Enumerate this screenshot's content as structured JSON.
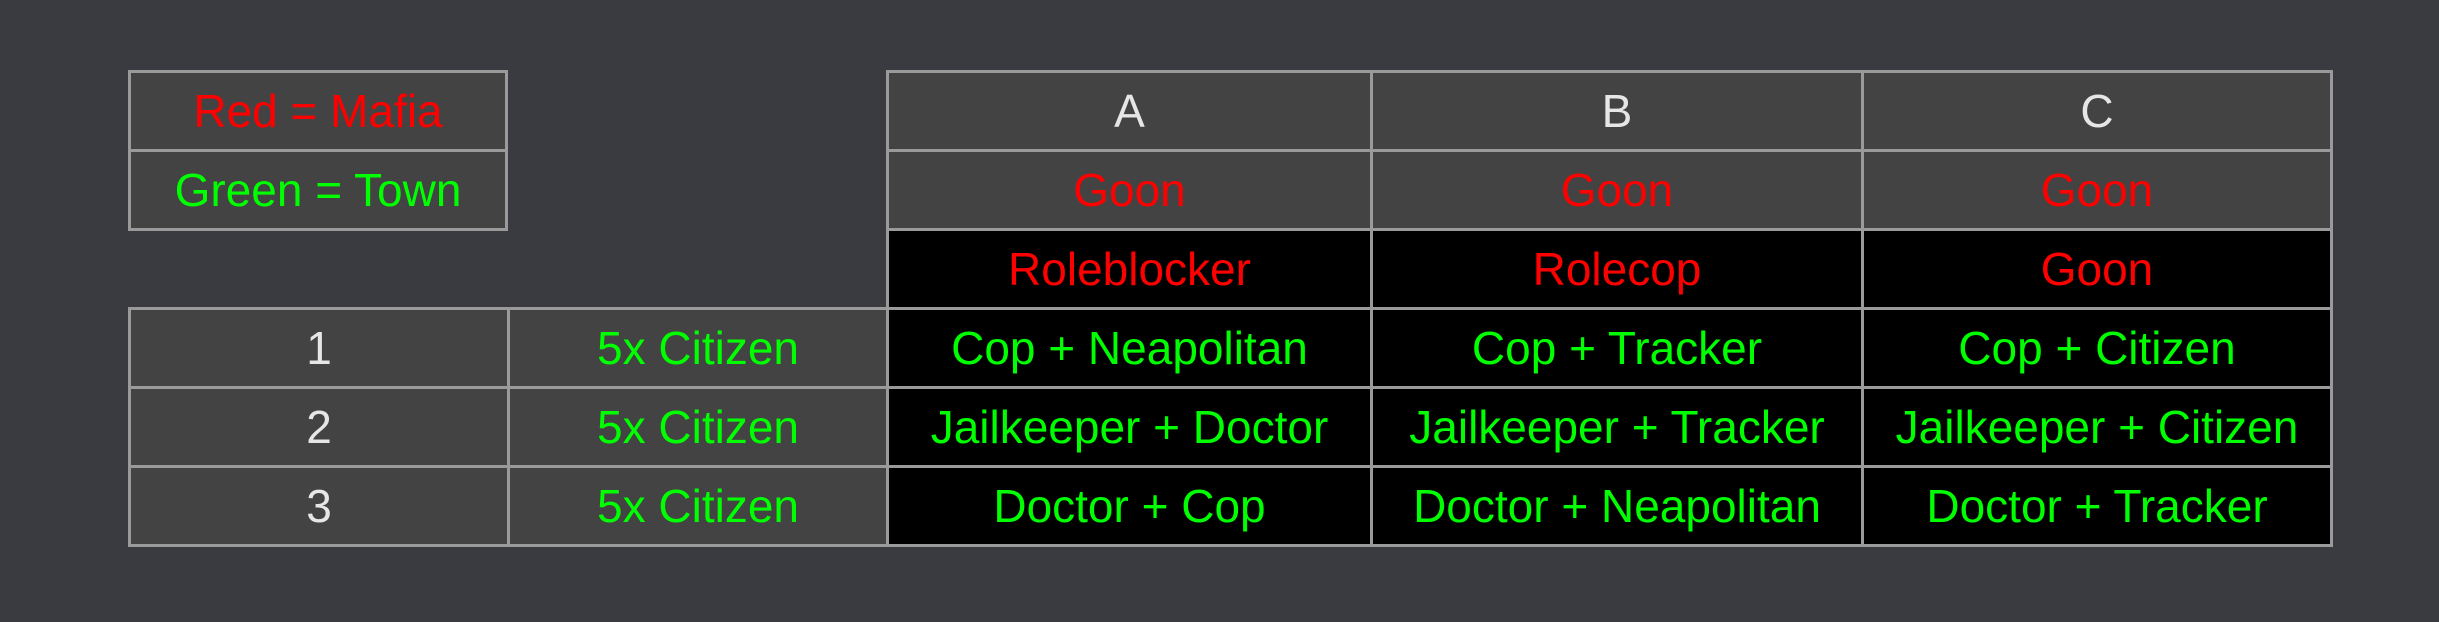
{
  "legend": [
    {
      "text": "Red = Mafia",
      "color": "#ff0000"
    },
    {
      "text": "Green = Town",
      "color": "#00ff00"
    }
  ],
  "columns": [
    "A",
    "B",
    "C"
  ],
  "mafia_rows": [
    [
      "Goon",
      "Goon",
      "Goon"
    ],
    [
      "Roleblocker",
      "Rolecop",
      "Goon"
    ]
  ],
  "town_rows": [
    {
      "label": "1",
      "base": "5x Citizen",
      "cells": [
        "Cop + Neapolitan",
        "Cop + Tracker",
        "Cop + Citizen"
      ]
    },
    {
      "label": "2",
      "base": "5x Citizen",
      "cells": [
        "Jailkeeper + Doctor",
        "Jailkeeper + Tracker",
        "Jailkeeper + Citizen"
      ]
    },
    {
      "label": "3",
      "base": "5x Citizen",
      "cells": [
        "Doctor + Cop",
        "Doctor + Neapolitan",
        "Doctor + Tracker"
      ]
    }
  ],
  "colors": {
    "mafia": "#ff0000",
    "town": "#00ff00",
    "header_bg": "#434343",
    "cell_bg": "#000000",
    "page_bg": "#393b40"
  }
}
